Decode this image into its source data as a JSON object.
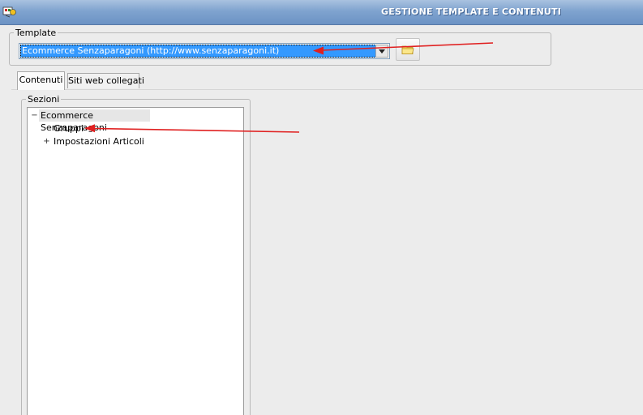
{
  "window": {
    "title": "GESTIONE TEMPLATE E CONTENUTI",
    "icon": "app-icon"
  },
  "template": {
    "label": "Template",
    "selected": "Ecommerce Senzaparagoni  (http://www.senzaparagoni.it)",
    "dropdown_icon": "chevron-down-icon",
    "browse_icon": "folder-icon"
  },
  "tabs": [
    {
      "label": "Contenuti",
      "active": true
    },
    {
      "label": "Siti web collegati",
      "active": false
    }
  ],
  "sections": {
    "label": "Sezioni",
    "tree": [
      {
        "label": "Ecommerce Senzaparagoni",
        "toggle": "−",
        "level": 0,
        "selected": true
      },
      {
        "label": "Gruppi",
        "toggle": "",
        "level": 1
      },
      {
        "label": "Impostazioni Articoli",
        "toggle": "+",
        "level": 1
      }
    ]
  },
  "colors": {
    "title_bar": "#7fa3cf",
    "selection": "#3399ff",
    "annotation_arrow": "#e02020"
  }
}
